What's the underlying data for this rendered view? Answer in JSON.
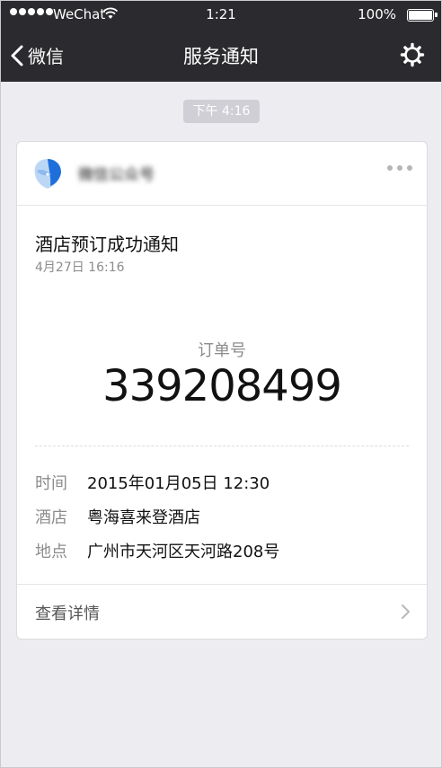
{
  "status_bar": {
    "carrier": "WeChat",
    "time": "1:21",
    "battery": "100%"
  },
  "nav": {
    "back_label": "微信",
    "title": "服务通知"
  },
  "message_time": "下午 4:16",
  "card": {
    "account_name": "微信公众号",
    "title": "酒店预订成功通知",
    "date": "4月27日 16:16",
    "order_label": "订单号",
    "order_number": "339208499",
    "rows": [
      {
        "key": "时间",
        "value": "2015年01月05日 12:30"
      },
      {
        "key": "酒店",
        "value": "粤海喜来登酒店"
      },
      {
        "key": "地点",
        "value": "广州市天河区天河路208号"
      }
    ],
    "footer": "查看详情"
  },
  "icons": {
    "back": "chevron-left-icon",
    "settings": "gear-icon",
    "more": "ellipsis-icon",
    "details": "chevron-right-icon"
  }
}
